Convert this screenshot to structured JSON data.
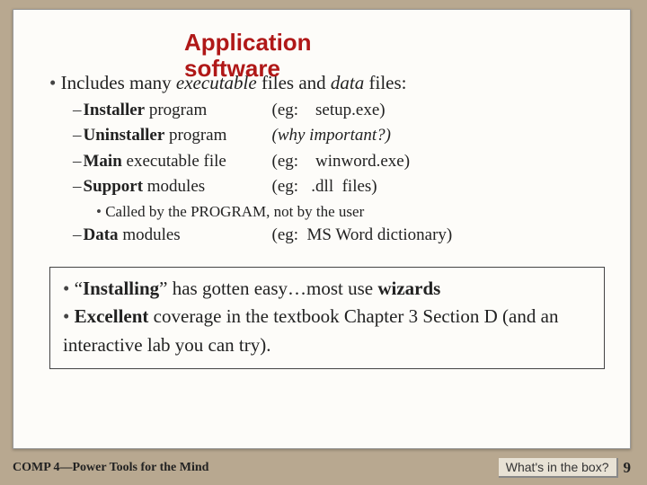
{
  "title": "Application software",
  "intro": {
    "lead": "Includes many ",
    "e1": "executable",
    "mid": " files and ",
    "e2": "data",
    "tail": " files:"
  },
  "rows": [
    {
      "bold": "Installer",
      "rest": " program",
      "eg": "(eg:    setup.exe)"
    },
    {
      "bold": "Uninstaller",
      "rest": " program",
      "eg": "(why important?)",
      "egItalic": true
    },
    {
      "bold": "Main",
      "rest": " executable file",
      "eg": "(eg:    winword.exe)"
    },
    {
      "bold": "Support",
      "rest": " modules",
      "eg": "(eg:   .dll  files)"
    }
  ],
  "sub3": "Called by the PROGRAM, not by the user",
  "row5": {
    "bold": "Data",
    "rest": " modules",
    "eg": "(eg:  MS Word dictionary)"
  },
  "box": {
    "a1": "“",
    "a2": "Installing",
    "a3": "” has gotten easy…most use ",
    "a4": "wizards",
    "b1": "Excellent",
    "b2": " coverage in the textbook Chapter 3 Section D (and an interactive lab you can try)."
  },
  "footer": {
    "course": "COMP 4—Power Tools for the Mind",
    "box": "What's in the box?",
    "page": "9"
  }
}
